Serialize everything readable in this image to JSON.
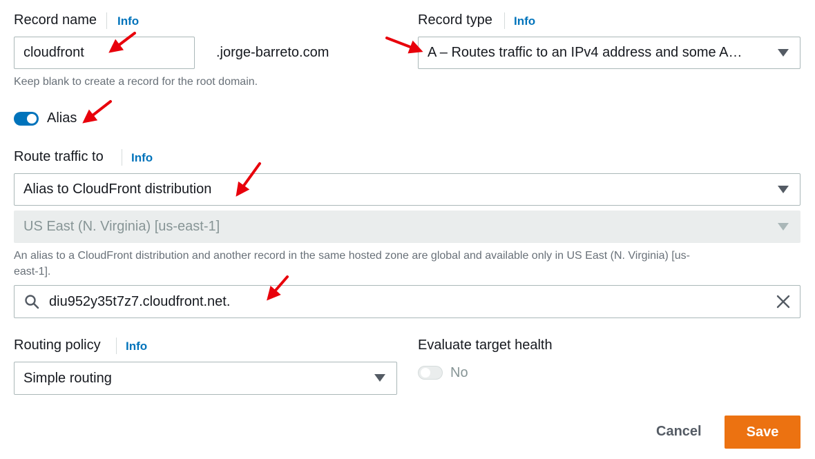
{
  "record_name": {
    "label": "Record name",
    "info": "Info",
    "value": "cloudfront",
    "domain_suffix": ".jorge-barreto.com",
    "help": "Keep blank to create a record for the root domain."
  },
  "record_type": {
    "label": "Record type",
    "info": "Info",
    "value": "A – Routes traffic to an IPv4 address and some A…"
  },
  "alias": {
    "label": "Alias",
    "enabled": true
  },
  "route_traffic": {
    "label": "Route traffic to",
    "info": "Info",
    "target": "Alias to CloudFront distribution",
    "region": "US East (N. Virginia) [us-east-1]",
    "help_line1": "An alias to a CloudFront distribution and another record in the same hosted zone are global and available only in US East (N. Virginia) [us-",
    "help_line2": "east-1].",
    "distribution": "diu952y35t7z7.cloudfront.net."
  },
  "routing_policy": {
    "label": "Routing policy",
    "info": "Info",
    "value": "Simple routing"
  },
  "evaluate_health": {
    "label": "Evaluate target health",
    "value": "No",
    "enabled": false
  },
  "actions": {
    "cancel": "Cancel",
    "save": "Save"
  },
  "colors": {
    "link": "#0073bb",
    "primary": "#ec7211",
    "toggle_on": "#0073bb",
    "annotation_arrow": "#e8000b"
  }
}
